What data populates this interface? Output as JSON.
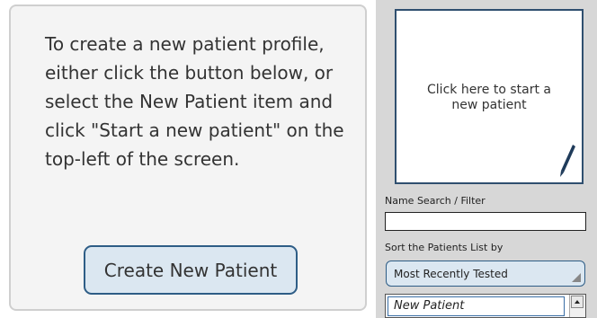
{
  "instructions": {
    "text": "To create a new patient profile, either click the button below, or select the New Patient item and click \"Start a new patient\" on the top-left of the screen."
  },
  "buttons": {
    "create_new_patient": "Create New Patient"
  },
  "start_box": {
    "text": "Click here to start a new patient",
    "icon": "pencil-icon"
  },
  "filter": {
    "label": "Name Search / Filter",
    "value": "",
    "placeholder": ""
  },
  "sort": {
    "label": "Sort the Patients List by",
    "selected": "Most Recently Tested"
  },
  "patients_list": {
    "items": [
      "New Patient"
    ]
  },
  "colors": {
    "accent": "#2e5d86",
    "button_fill": "#dbe7f1",
    "sidebar_bg": "#d7d7d7"
  }
}
